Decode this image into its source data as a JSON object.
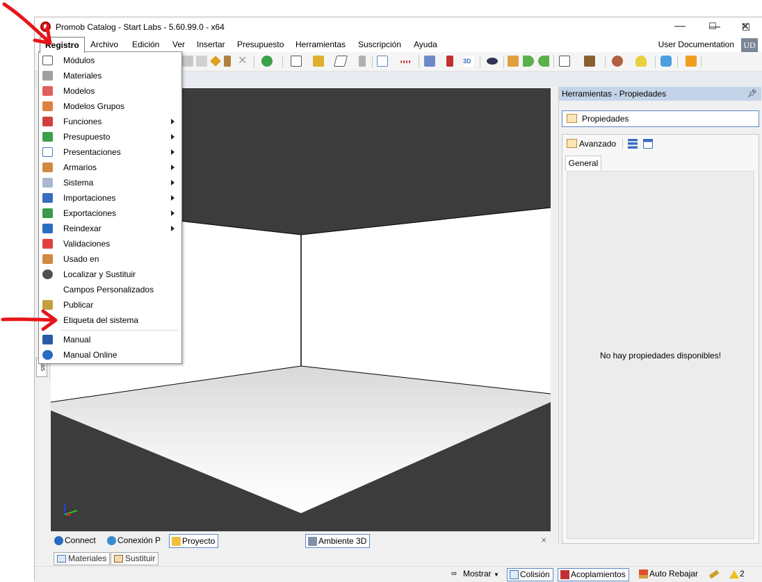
{
  "window": {
    "title": "Promob Catalog - Start Labs - 5.60.99.0 - x64",
    "minimize_glyph": "—",
    "maximize_glyph": "☐",
    "close_glyph": "✕"
  },
  "menubar": {
    "items": [
      "Registro",
      "Archivo",
      "Edición",
      "Ver",
      "Insertar",
      "Presupuesto",
      "Herramientas",
      "Suscripción",
      "Ayuda"
    ],
    "active": "Registro",
    "user_doc": "User Documentation",
    "user_initials": "UD"
  },
  "dropdown": {
    "items": [
      {
        "label": "Módulos",
        "icon": "modules-icon",
        "submenu": false
      },
      {
        "label": "Materiales",
        "icon": "materials-icon",
        "submenu": false
      },
      {
        "label": "Modelos",
        "icon": "models-icon",
        "submenu": false
      },
      {
        "label": "Modelos Grupos",
        "icon": "model-groups-icon",
        "submenu": false
      },
      {
        "label": "Funciones",
        "icon": "functions-icon",
        "submenu": true
      },
      {
        "label": "Presupuesto",
        "icon": "budget-icon",
        "submenu": true
      },
      {
        "label": "Presentaciones",
        "icon": "presentations-icon",
        "submenu": true
      },
      {
        "label": "Armarios",
        "icon": "wardrobes-icon",
        "submenu": true
      },
      {
        "label": "Sistema",
        "icon": "system-gear-icon",
        "submenu": true
      },
      {
        "label": "Importaciones",
        "icon": "imports-icon",
        "submenu": true
      },
      {
        "label": "Exportaciones",
        "icon": "exports-icon",
        "submenu": true
      },
      {
        "label": "Reindexar",
        "icon": "reindex-icon",
        "submenu": true
      },
      {
        "label": "Validaciones",
        "icon": "validations-icon",
        "submenu": false
      },
      {
        "label": "Usado en",
        "icon": "used-in-icon",
        "submenu": false
      },
      {
        "label": "Localizar y Sustituir",
        "icon": "search-icon",
        "submenu": false
      },
      {
        "label": "Campos Personalizados",
        "icon": "",
        "submenu": false
      },
      {
        "label": "Publicar",
        "icon": "publish-icon",
        "submenu": false
      },
      {
        "label": "Etiqueta del sistema",
        "icon": "",
        "submenu": false
      },
      {
        "label": "Manual",
        "icon": "manual-book-icon",
        "submenu": false
      },
      {
        "label": "Manual Online",
        "icon": "help-icon",
        "submenu": false
      }
    ]
  },
  "right_panel": {
    "header": "Herramientas - Propiedades",
    "properties_button": "Propiedades",
    "advanced_label": "Avanzado",
    "tab_general": "General",
    "empty_message": "No hay propiedades disponibles!"
  },
  "bottom_tabs": {
    "connect": "Connect",
    "conexion": "Conexión P",
    "proyecto": "Proyecto",
    "ambiente": "Ambiente 3D",
    "close": "×"
  },
  "lower_tabs": {
    "materiales": "Materiales",
    "sustituir": "Sustituir"
  },
  "left_strip": {
    "tab_text": "as"
  },
  "statusbar": {
    "mostrar": "Mostrar",
    "colision": "Colisión",
    "acoplamientos": "Acoplamientos",
    "auto_rebajar": "Auto Rebajar",
    "warnings": "2"
  },
  "colors": {
    "accent_blue": "#5b88c4",
    "panel_header": "#c4d4e8",
    "viewport_dark": "#3c3c3c",
    "annotation_red": "#e8141b"
  }
}
